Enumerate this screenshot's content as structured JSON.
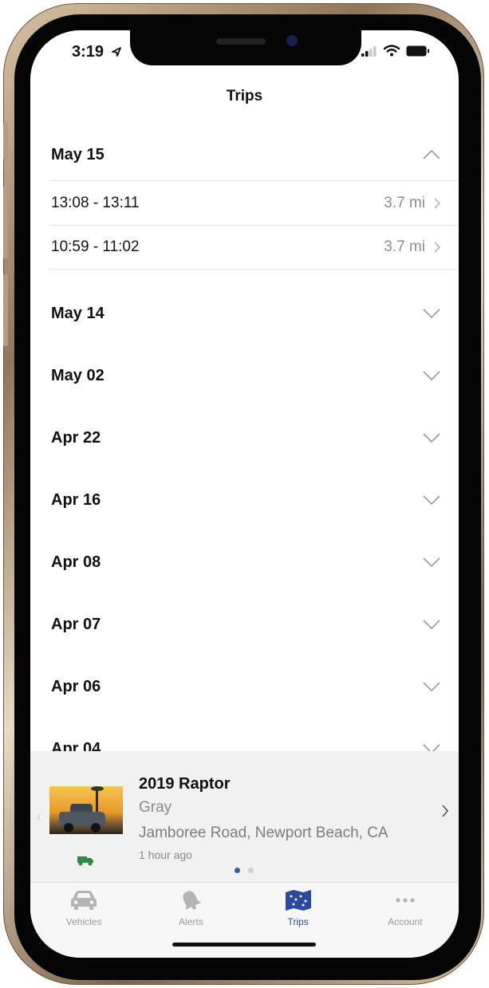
{
  "status_bar": {
    "time": "3:19"
  },
  "header": {
    "title": "Trips"
  },
  "trip_groups": [
    {
      "date": "May 15",
      "expanded": true,
      "trips": [
        {
          "time_range": "13:08 - 13:11",
          "distance": "3.7 mi"
        },
        {
          "time_range": "10:59 - 11:02",
          "distance": "3.7 mi"
        }
      ]
    },
    {
      "date": "May 14",
      "expanded": false
    },
    {
      "date": "May 02",
      "expanded": false
    },
    {
      "date": "Apr 22",
      "expanded": false
    },
    {
      "date": "Apr 16",
      "expanded": false
    },
    {
      "date": "Apr 08",
      "expanded": false
    },
    {
      "date": "Apr 07",
      "expanded": false
    },
    {
      "date": "Apr 06",
      "expanded": false
    },
    {
      "date": "Apr 04",
      "expanded": false
    }
  ],
  "vehicle_card": {
    "name": "2019 Raptor",
    "color": "Gray",
    "location": "Jamboree Road, Newport Beach, CA",
    "updated": "1 hour ago",
    "pager": {
      "current": 1,
      "total": 2
    }
  },
  "tab_bar": {
    "tabs": [
      {
        "label": "Vehicles",
        "icon": "car-icon",
        "active": false
      },
      {
        "label": "Alerts",
        "icon": "bell-icon",
        "active": false
      },
      {
        "label": "Trips",
        "icon": "map-icon",
        "active": true
      },
      {
        "label": "Account",
        "icon": "more-icon",
        "active": false
      }
    ]
  },
  "colors": {
    "accent": "#2b4a9c",
    "vehicle_status": "#2f8a4a",
    "card_background": "#f1f1f1"
  }
}
